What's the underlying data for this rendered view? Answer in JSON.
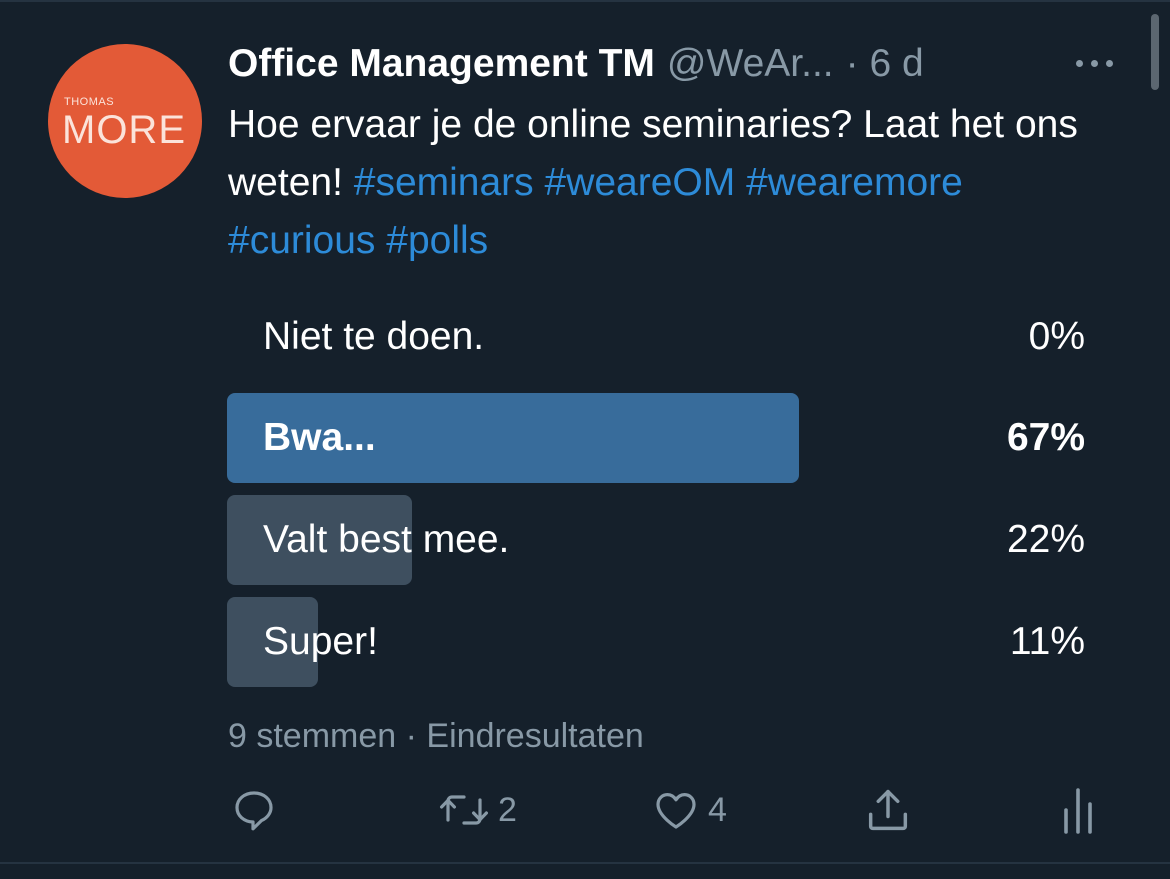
{
  "tweet": {
    "author": {
      "display_name": "Office Management TM",
      "handle": "@WeAr...",
      "time": "· 6 d",
      "avatar": {
        "text_small": "THOMAS",
        "text_big": "MORE",
        "color": "#e35a37"
      }
    },
    "text": {
      "plain": "Hoe ervaar je de online seminaries? Laat het ons weten! ",
      "hashtags": [
        "#seminars",
        "#weareOM",
        "#wearemore",
        "#curious",
        "#polls"
      ]
    },
    "poll": {
      "options": [
        {
          "label": "Niet te doen.",
          "percent_text": "0%",
          "percent": 0,
          "winner": false
        },
        {
          "label": "Bwa...",
          "percent_text": "67%",
          "percent": 67,
          "winner": true
        },
        {
          "label": "Valt best mee.",
          "percent_text": "22%",
          "percent": 22,
          "winner": false
        },
        {
          "label": "Super!",
          "percent_text": "11%",
          "percent": 11,
          "winner": false
        }
      ],
      "votes": "9 stemmen",
      "separator": "·",
      "status": "Eindresultaten"
    },
    "actions": {
      "reply": {
        "icon": "reply-icon",
        "count": ""
      },
      "retweet": {
        "icon": "retweet-icon",
        "count": "2"
      },
      "like": {
        "icon": "heart-icon",
        "count": "4"
      },
      "share": {
        "icon": "share-icon",
        "count": ""
      },
      "analytics": {
        "icon": "analytics-icon",
        "count": ""
      }
    }
  },
  "colors": {
    "background": "#15202b",
    "hashtag": "#2d8bd8",
    "muted": "#8899a6",
    "winner_bar": "#386c9b",
    "bar": "#3e4f5f"
  }
}
